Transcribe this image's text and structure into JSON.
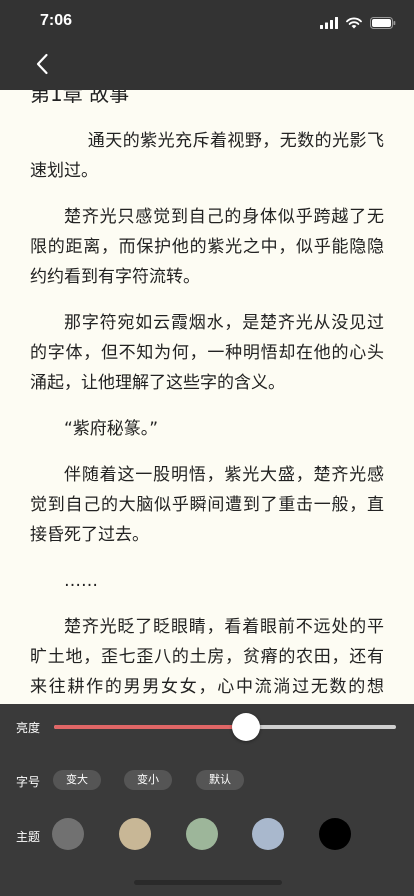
{
  "status_bar": {
    "time": "7:06"
  },
  "chapter": {
    "title": "第1章 故事",
    "paragraphs": [
      "通天的紫光充斥着视野，无数的光影飞速划过。",
      "楚齐光只感觉到自己的身体似乎跨越了无限的距离，而保护他的紫光之中，似乎能隐隐约约看到有字符流转。",
      "那字符宛如云霞烟水，是楚齐光从没见过的字体，但不知为何，一种明悟却在他的心头涌起，让他理解了这些字的含义。",
      "“紫府秘篆。”",
      "伴随着这一股明悟，紫光大盛，楚齐光感觉到自己的大脑似乎瞬间遭到了重击一般，直接昏死了过去。",
      "……",
      "楚齐光眨了眨眼睛，看着眼前不远处的平旷土地，歪七歪八的土房，贫瘠的农田，还有来往耕作的男男女女，心中流淌过无数的想法。"
    ]
  },
  "settings": {
    "brightness": {
      "label": "亮度",
      "value": 0.56
    },
    "font_size": {
      "label": "字号",
      "bigger": "变大",
      "smaller": "变小",
      "default": "默认"
    },
    "theme": {
      "label": "主题",
      "colors": [
        "#717171",
        "#c8b796",
        "#9db69a",
        "#a9b8cd",
        "#000000"
      ]
    }
  },
  "colors": {
    "accent": "#e06666",
    "topbar": "#333333",
    "panel": "#3a3a3a",
    "page": "#fdfcf3"
  }
}
